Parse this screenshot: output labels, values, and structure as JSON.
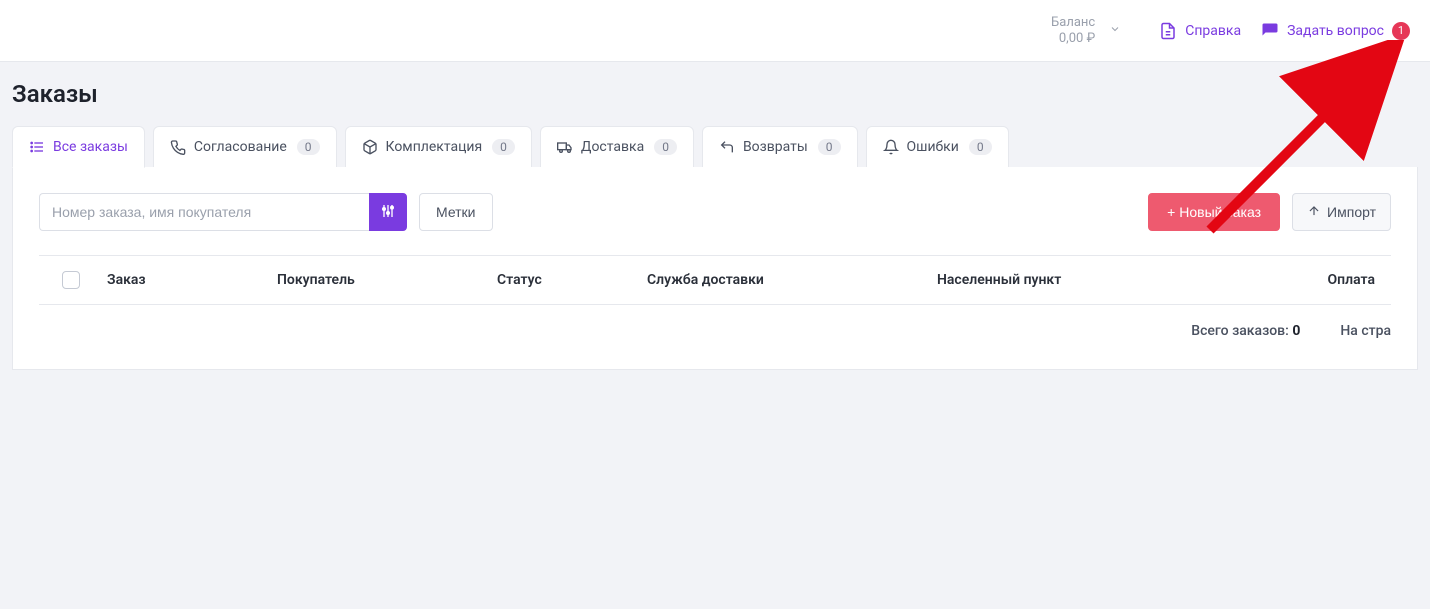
{
  "topbar": {
    "balance_label": "Баланс",
    "balance_value": "0,00 ₽",
    "help_label": "Справка",
    "ask_label": "Задать вопрос",
    "ask_badge": "1"
  },
  "page": {
    "title": "Заказы"
  },
  "tabs": [
    {
      "id": "all",
      "label": "Все заказы",
      "count": null,
      "active": true,
      "icon": "list-icon"
    },
    {
      "id": "approval",
      "label": "Согласование",
      "count": "0",
      "active": false,
      "icon": "phone-icon"
    },
    {
      "id": "packing",
      "label": "Комплектация",
      "count": "0",
      "active": false,
      "icon": "box-icon"
    },
    {
      "id": "delivery",
      "label": "Доставка",
      "count": "0",
      "active": false,
      "icon": "truck-icon"
    },
    {
      "id": "returns",
      "label": "Возвраты",
      "count": "0",
      "active": false,
      "icon": "return-icon"
    },
    {
      "id": "errors",
      "label": "Ошибки",
      "count": "0",
      "active": false,
      "icon": "bell-icon"
    }
  ],
  "filters": {
    "search_placeholder": "Номер заказа, имя покупателя",
    "labels_button": "Метки",
    "new_order_button": "Новый заказ",
    "import_button": "Импорт"
  },
  "table": {
    "columns": {
      "order": "Заказ",
      "buyer": "Покупатель",
      "status": "Статус",
      "delivery": "Служба доставки",
      "city": "Населенный пункт",
      "payment": "Оплата"
    },
    "rows": []
  },
  "footer": {
    "total_label": "Всего заказов:",
    "total_value": "0",
    "per_page_label": "На стра"
  }
}
